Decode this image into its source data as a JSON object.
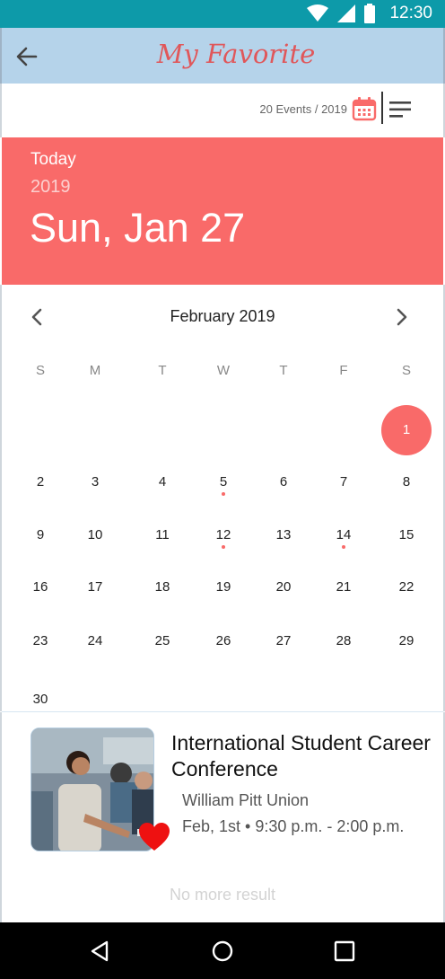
{
  "status_bar": {
    "time": "12:30"
  },
  "app_bar": {
    "title": "My Favorite"
  },
  "toolbar": {
    "events_count": "20 Events / 2019"
  },
  "today": {
    "label": "Today",
    "year": "2019",
    "date": "Sun, Jan 27"
  },
  "calendar": {
    "month": "February 2019",
    "weekdays": [
      "S",
      "M",
      "T",
      "W",
      "T",
      "F",
      "S"
    ],
    "weeks": [
      [
        "",
        "",
        "",
        "",
        "",
        "",
        "1"
      ],
      [
        "2",
        "3",
        "4",
        "5",
        "6",
        "7",
        "8"
      ],
      [
        "9",
        "10",
        "11",
        "12",
        "13",
        "14",
        "15"
      ],
      [
        "16",
        "17",
        "18",
        "19",
        "20",
        "21",
        "22"
      ],
      [
        "23",
        "24",
        "25",
        "26",
        "27",
        "28",
        "29"
      ],
      [
        "30",
        "",
        "",
        "",
        "",
        "",
        ""
      ]
    ],
    "selected_day": "1",
    "event_days": [
      "5",
      "12",
      "14"
    ],
    "accent_color": "#f96a69"
  },
  "event": {
    "title": "International Student Career Conference",
    "venue": "William Pitt Union",
    "time": "Feb, 1st • 9:30 p.m. - 2:00 p.m.",
    "favorited": true
  },
  "footer": {
    "no_more": "No more result"
  },
  "colors": {
    "status_bar": "#0d9aa9",
    "app_bar": "#b5d3ea",
    "banner": "#f96a69",
    "title_text": "#e0575a"
  }
}
